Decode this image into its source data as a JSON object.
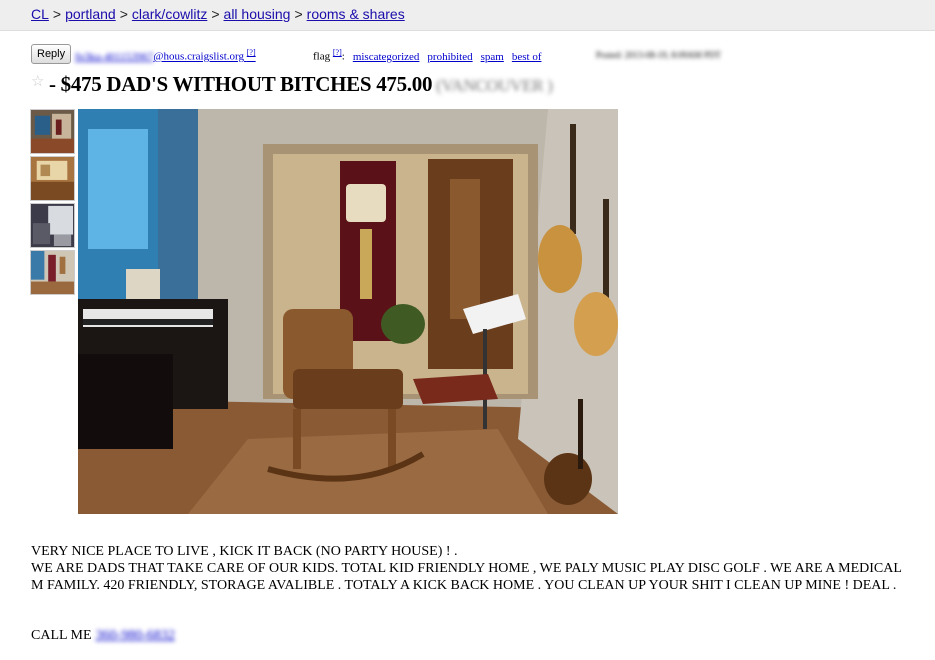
{
  "breadcrumb": {
    "items": [
      "CL",
      "portland",
      "clark/cowlitz",
      "all housing",
      "rooms & shares"
    ],
    "separator": ">"
  },
  "posting": {
    "reply_label": "Reply",
    "email_user": "fp3ku-401153967",
    "email_domain": "@hous.craigslist.org",
    "email_footnote": "[?]",
    "flag_label": "flag",
    "flag_footnote": "[?]",
    "flag_colon": ":",
    "flag_options": [
      "miscategorized",
      "prohibited",
      "spam",
      "best of"
    ],
    "posted": "Posted: 2013-08-19, 8:09AM PDT",
    "title": "- $475 DAD'S WITHOUT BITCHES 475.00",
    "location": "(VANCOUVER )",
    "star_icon": "star-icon",
    "body_paragraph_1": "VERY NICE PLACE TO LIVE , KICK IT BACK (NO PARTY HOUSE) ! .",
    "body_paragraph_2": "WE ARE DADS THAT TAKE CARE OF OUR KIDS. TOTAL KID FRIENDLY HOME , WE PALY MUSIC PLAY DISC GOLF . WE ARE A MEDICAL M FAMILY. 420 FRIENDLY, STORAGE AVALIBLE . TOTALY A KICK BACK HOME . YOU CLEAN UP YOUR SHIT I CLEAN UP MINE ! DEAL .",
    "call_label": "CALL ME",
    "phone": "360-980-6832"
  },
  "colors": {
    "link": "#1a0dab",
    "body_link": "#0000cc",
    "header_bg": "#eeeeee"
  }
}
